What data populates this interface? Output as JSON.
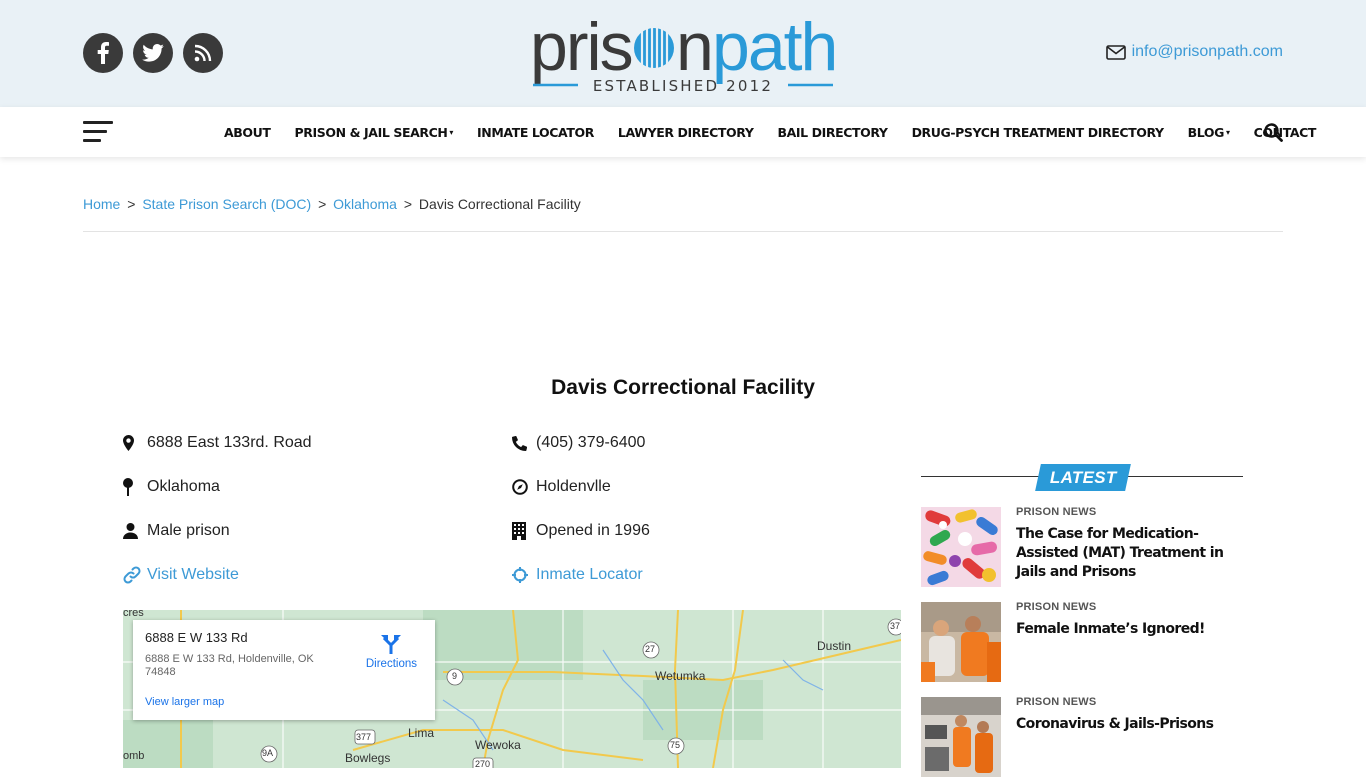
{
  "brand": {
    "logo_text_main": "prisonpath",
    "logo_tagline": "ESTABLISHED 2012",
    "accent_color": "#3d9ad6",
    "dark_color": "#3a3a3a"
  },
  "header": {
    "social": [
      {
        "icon": "facebook-icon"
      },
      {
        "icon": "twitter-icon"
      },
      {
        "icon": "rss-icon"
      }
    ],
    "email": "info@prisonpath.com"
  },
  "nav": {
    "items": [
      {
        "label": "ABOUT",
        "dropdown": false
      },
      {
        "label": "PRISON & JAIL SEARCH",
        "dropdown": true
      },
      {
        "label": "INMATE LOCATOR",
        "dropdown": false
      },
      {
        "label": "LAWYER DIRECTORY",
        "dropdown": false
      },
      {
        "label": "BAIL DIRECTORY",
        "dropdown": false
      },
      {
        "label": "DRUG-PSYCH TREATMENT DIRECTORY",
        "dropdown": false
      },
      {
        "label": "BLOG",
        "dropdown": true
      },
      {
        "label": "CONTACT",
        "dropdown": false
      }
    ]
  },
  "breadcrumb": {
    "home": "Home",
    "state": "State Prison Search (DOC)",
    "region": "Oklahoma",
    "current": "Davis Correctional Facility",
    "sep": ">"
  },
  "facility": {
    "title": "Davis Correctional Facility",
    "address": "6888 East 133rd. Road",
    "phone": "(405) 379-6400",
    "state": "Oklahoma",
    "city": "Holdenvlle",
    "type": "Male prison",
    "opened": "Opened in 1996",
    "website_label": "Visit Website",
    "locator_label": "Inmate Locator"
  },
  "map": {
    "card_title": "6888 E W 133 Rd",
    "card_address": "6888 E W 133 Rd, Holdenville, OK 74848",
    "larger_map": "View larger map",
    "directions": "Directions",
    "labels": {
      "cres": "cres",
      "wetumka": "Wetumka",
      "dustin": "Dustin",
      "lima": "Lima",
      "wewoka": "Wewoka",
      "bowlegs": "Bowlegs",
      "omb": "omb",
      "r27": "27",
      "r9": "9",
      "r377": "377",
      "r75": "75",
      "r9a": "9A",
      "r270": "270",
      "r37": "37"
    }
  },
  "sidebar": {
    "latest_label": "LATEST",
    "news": [
      {
        "category": "PRISON NEWS",
        "title": "The Case for Medication-Assisted (MAT) Treatment in Jails and Prisons"
      },
      {
        "category": "PRISON NEWS",
        "title": "Female Inmate’s Ignored!"
      },
      {
        "category": "PRISON NEWS",
        "title": "Coronavirus & Jails-Prisons"
      }
    ]
  }
}
